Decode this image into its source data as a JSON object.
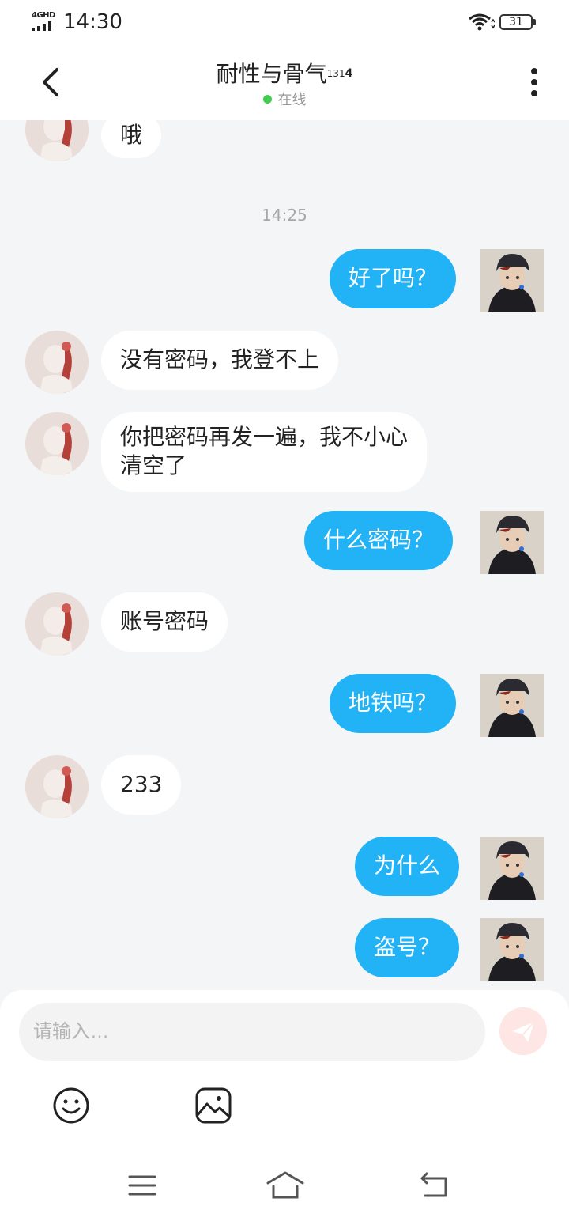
{
  "status_bar": {
    "network": "4GHD",
    "time": "14:30",
    "battery": "31"
  },
  "header": {
    "title": "耐性与骨气",
    "badge_small": "13",
    "badge_plain": "1",
    "badge_bold": "4",
    "presence": "在线"
  },
  "chat": {
    "timestamp": "14:25",
    "messages": [
      {
        "side": "in",
        "text": "哦"
      },
      {
        "side": "out",
        "text": "好了吗？"
      },
      {
        "side": "in",
        "text": "没有密码，我登不上"
      },
      {
        "side": "in",
        "line1": "你把密码再发一遍，我不小心",
        "line2": "清空了"
      },
      {
        "side": "out",
        "text": "什么密码？"
      },
      {
        "side": "in",
        "text": "账号密码"
      },
      {
        "side": "out",
        "text": "地铁吗？"
      },
      {
        "side": "in",
        "text": "233"
      },
      {
        "side": "out",
        "text": "为什么"
      },
      {
        "side": "out",
        "text": "盗号？"
      }
    ]
  },
  "composer": {
    "placeholder": "请输入…",
    "send_icon": "paper-plane-icon",
    "emoji_icon": "smiley-icon",
    "image_icon": "image-icon"
  },
  "navigation": {
    "menu_icon": "menu-icon",
    "home_icon": "home-icon",
    "back_icon": "back-icon"
  },
  "colors": {
    "outgoing_bubble": "#21b3f6",
    "incoming_bubble": "#ffffff",
    "background": "#f4f5f7",
    "online_dot": "#3fce51",
    "send_button": "#fde6e3"
  }
}
